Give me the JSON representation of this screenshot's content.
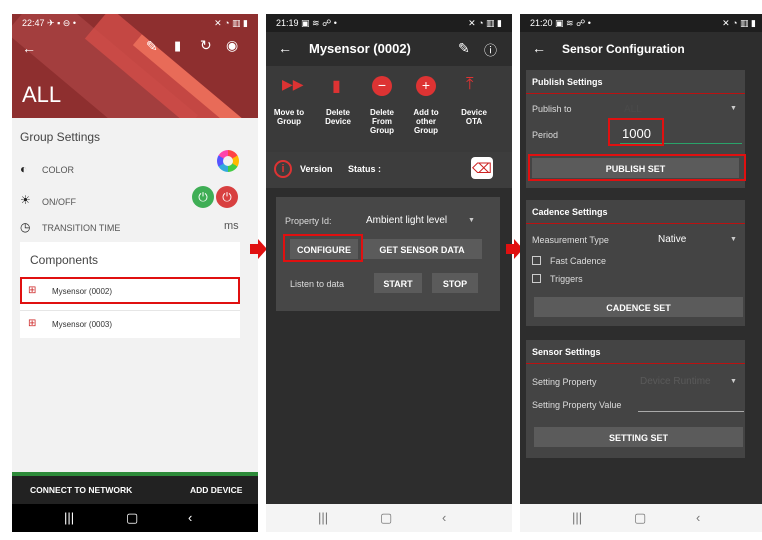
{
  "screen1": {
    "status_time": "22:47",
    "status_icons_left": "✈ ▪ ⊖ •",
    "status_icons_right": "✕ ◔ ▥ ▮",
    "title": "ALL",
    "group_settings_label": "Group Settings",
    "color_label": "COLOR",
    "onoff_label": "ON/OFF",
    "transition_label": "TRANSITION TIME",
    "transition_unit": "ms",
    "components_label": "Components",
    "components": [
      "Mysensor (0002)",
      "Mysensor (0003)"
    ],
    "bottom_left": "CONNECT TO NETWORK",
    "bottom_right": "ADD DEVICE"
  },
  "screen2": {
    "status_time": "21:19",
    "status_icons_left": "▣ ≋ ☍ •",
    "status_icons_right": "✕ ◔ ▥ ▮",
    "title": "Mysensor (0002)",
    "actions": [
      {
        "label": "Move to Group",
        "icon": "fast-forward-icon"
      },
      {
        "label": "Delete Device",
        "icon": "trash-icon"
      },
      {
        "label": "Delete From Group",
        "icon": "minus-circle-icon"
      },
      {
        "label": "Add to other Group",
        "icon": "plus-circle-icon"
      },
      {
        "label": "Device OTA",
        "icon": "upload-icon"
      }
    ],
    "version_label": "Version",
    "status_label": "Status :",
    "property_id_label": "Property Id:",
    "property_value": "Ambient light level",
    "configure_label": "CONFIGURE",
    "get_sensor_data_label": "GET SENSOR DATA",
    "listen_label": "Listen to data",
    "start_label": "START",
    "stop_label": "STOP"
  },
  "screen3": {
    "status_time": "21:20",
    "status_icons_left": "▣ ≋ ☍ •",
    "status_icons_right": "✕ ◔ ▥ ▮",
    "title": "Sensor Configuration",
    "publish_header": "Publish Settings",
    "publish_to_label": "Publish to",
    "publish_to_value": "ALL",
    "period_label": "Period",
    "period_value": "1000",
    "publish_set_label": "PUBLISH SET",
    "cadence_header": "Cadence Settings",
    "measurement_label": "Measurement Type",
    "measurement_value": "Native",
    "fast_cadence_label": "Fast Cadence",
    "triggers_label": "Triggers",
    "cadence_set_label": "CADENCE SET",
    "sensor_header": "Sensor Settings",
    "setting_property_label": "Setting Property",
    "setting_property_value": "Device Runtime",
    "setting_property_value_label": "Setting Property Value",
    "setting_set_label": "SETTING SET"
  },
  "colors": {
    "accent_red": "#e01010",
    "on_green": "#3fae55",
    "off_red": "#d84040",
    "dark_bg": "#2d2d2d"
  }
}
